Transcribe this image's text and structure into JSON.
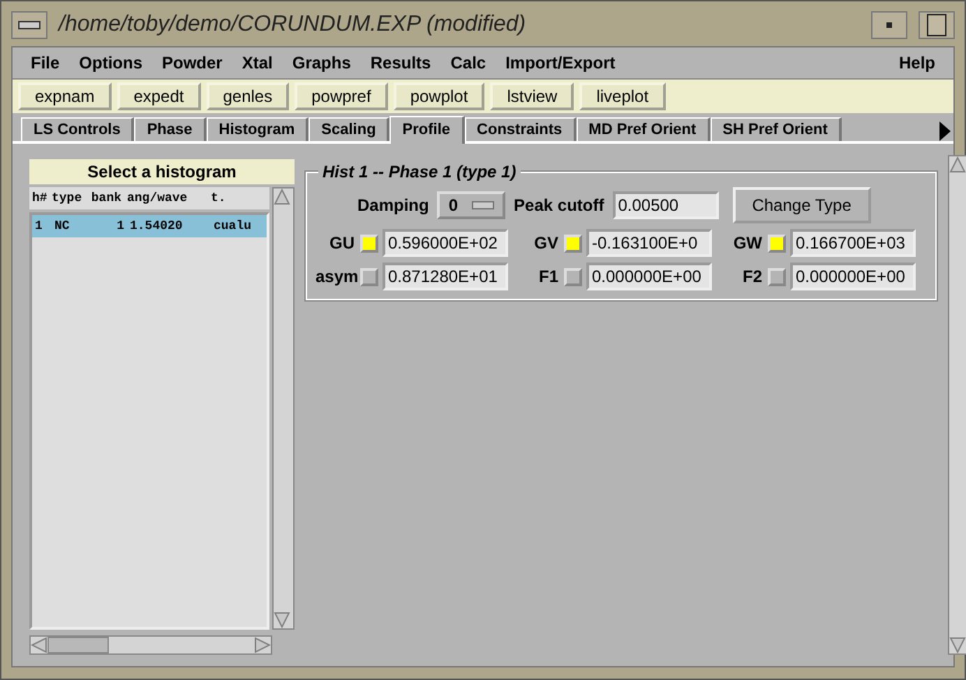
{
  "window": {
    "title": "/home/toby/demo/CORUNDUM.EXP (modified)"
  },
  "menu": {
    "left": [
      "File",
      "Options",
      "Powder",
      "Xtal",
      "Graphs",
      "Results",
      "Calc",
      "Import/Export"
    ],
    "right": [
      "Help"
    ]
  },
  "toolbar": [
    "expnam",
    "expedt",
    "genles",
    "powpref",
    "powplot",
    "lstview",
    "liveplot"
  ],
  "tabs": [
    {
      "label": "LS Controls",
      "selected": false
    },
    {
      "label": "Phase",
      "selected": false
    },
    {
      "label": "Histogram",
      "selected": false
    },
    {
      "label": "Scaling",
      "selected": false
    },
    {
      "label": "Profile",
      "selected": true
    },
    {
      "label": "Constraints",
      "selected": false
    },
    {
      "label": "MD Pref Orient",
      "selected": false
    },
    {
      "label": "SH Pref Orient",
      "selected": false
    }
  ],
  "histogram_list": {
    "title": "Select a histogram",
    "columns": [
      "h#",
      "type",
      "bank",
      "ang/wave",
      "t."
    ],
    "rows": [
      {
        "cells": [
          "1",
          "NC",
          "1",
          "1.54020",
          "cualu"
        ],
        "selected": true
      }
    ]
  },
  "profile": {
    "group_title": "Hist 1 -- Phase 1 (type 1)",
    "damping_label": "Damping",
    "damping": "0",
    "peak_cutoff_label": "Peak cutoff",
    "peak_cutoff": "0.00500",
    "change_type_button": "Change Type",
    "parameters": [
      [
        {
          "label": "GU",
          "checked": true,
          "value": "0.596000E+02"
        },
        {
          "label": "GV",
          "checked": true,
          "value": "-0.163100E+0"
        },
        {
          "label": "GW",
          "checked": true,
          "value": "0.166700E+03"
        }
      ],
      [
        {
          "label": "asym",
          "checked": false,
          "value": "0.871280E+01"
        },
        {
          "label": "F1",
          "checked": false,
          "value": "0.000000E+00"
        },
        {
          "label": "F2",
          "checked": false,
          "value": "0.000000E+00"
        }
      ]
    ]
  }
}
